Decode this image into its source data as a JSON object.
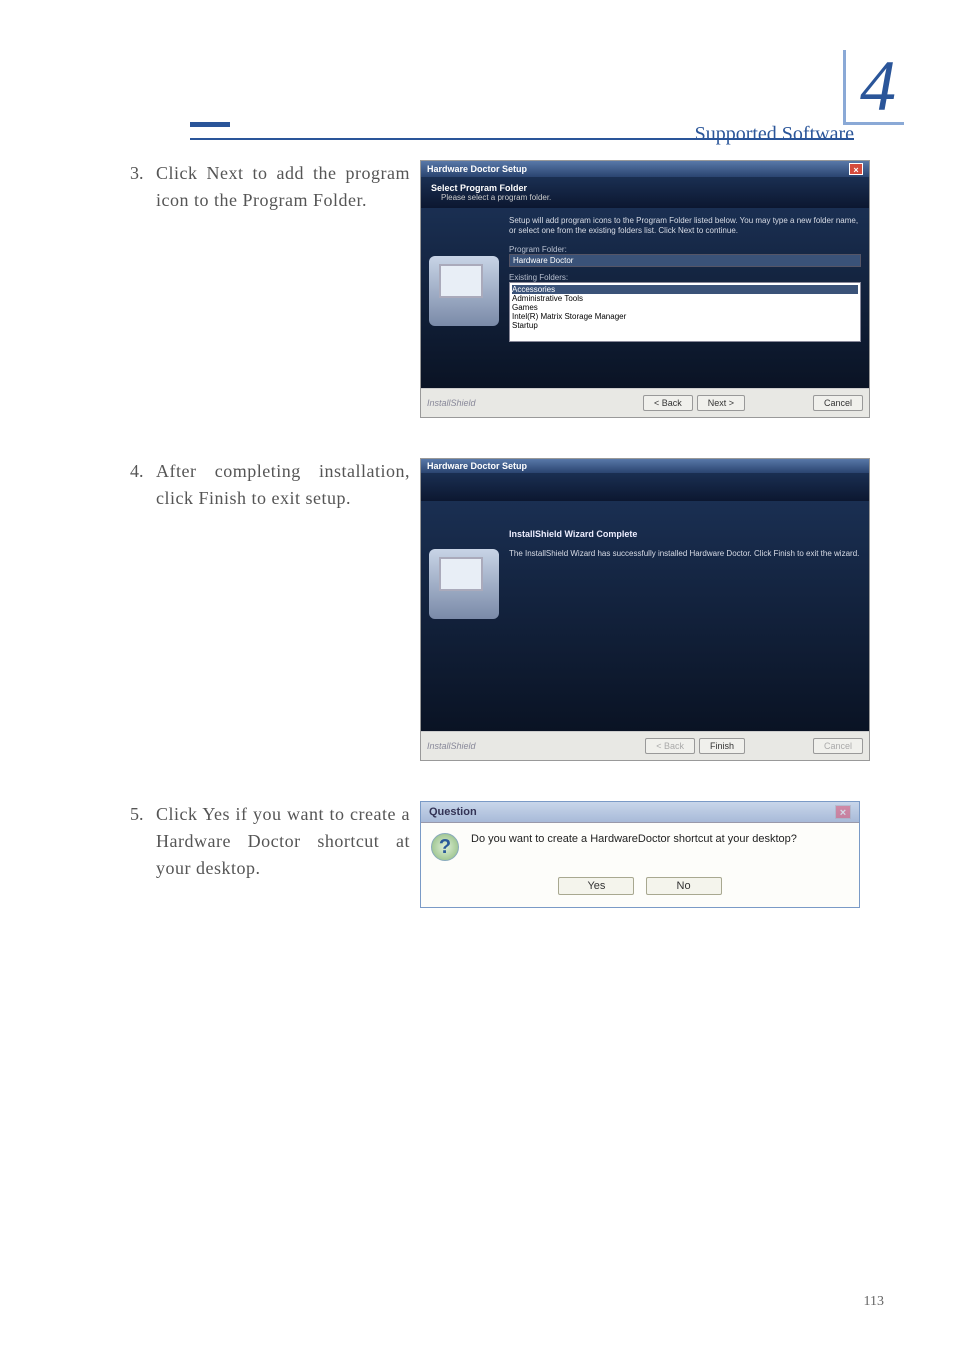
{
  "header": {
    "chapter_number": "4",
    "section_title": "Supported Software"
  },
  "page_number": "113",
  "steps": {
    "s3": {
      "number": "3.",
      "text": "Click Next to add the program icon to the Program Folder."
    },
    "s4": {
      "number": "4.",
      "text": "After completing instal­lation, click Finish to exit setup."
    },
    "s5": {
      "number": "5.",
      "text": "Click Yes if you want to create a Hardware Doctor shortcut at your desktop."
    }
  },
  "dialog1": {
    "title": "Hardware Doctor Setup",
    "banner_title": "Select Program Folder",
    "banner_sub": "Please select a program folder.",
    "description": "Setup will add program icons to the Program Folder listed below. You may type a new folder name, or select one from the existing folders list. Click Next to continue.",
    "label_folder": "Program Folder:",
    "folder_value": "Hardware Doctor",
    "label_existing": "Existing Folders:",
    "existing": [
      "Accessories",
      "Administrative Tools",
      "Games",
      "Intel(R) Matrix Storage Manager",
      "Startup"
    ],
    "brand": "InstallShield",
    "back": "< Back",
    "next": "Next >",
    "cancel": "Cancel"
  },
  "dialog2": {
    "title": "Hardware Doctor Setup",
    "heading": "InstallShield Wizard Complete",
    "body": "The InstallShield Wizard has successfully installed Hardware Doctor. Click Finish to exit the wizard.",
    "brand": "InstallShield",
    "back": "< Back",
    "finish": "Finish",
    "cancel": "Cancel"
  },
  "dialog3": {
    "title": "Question",
    "icon": "?",
    "message": "Do you want to create a HardwareDoctor shortcut at your desktop?",
    "yes": "Yes",
    "no": "No"
  }
}
